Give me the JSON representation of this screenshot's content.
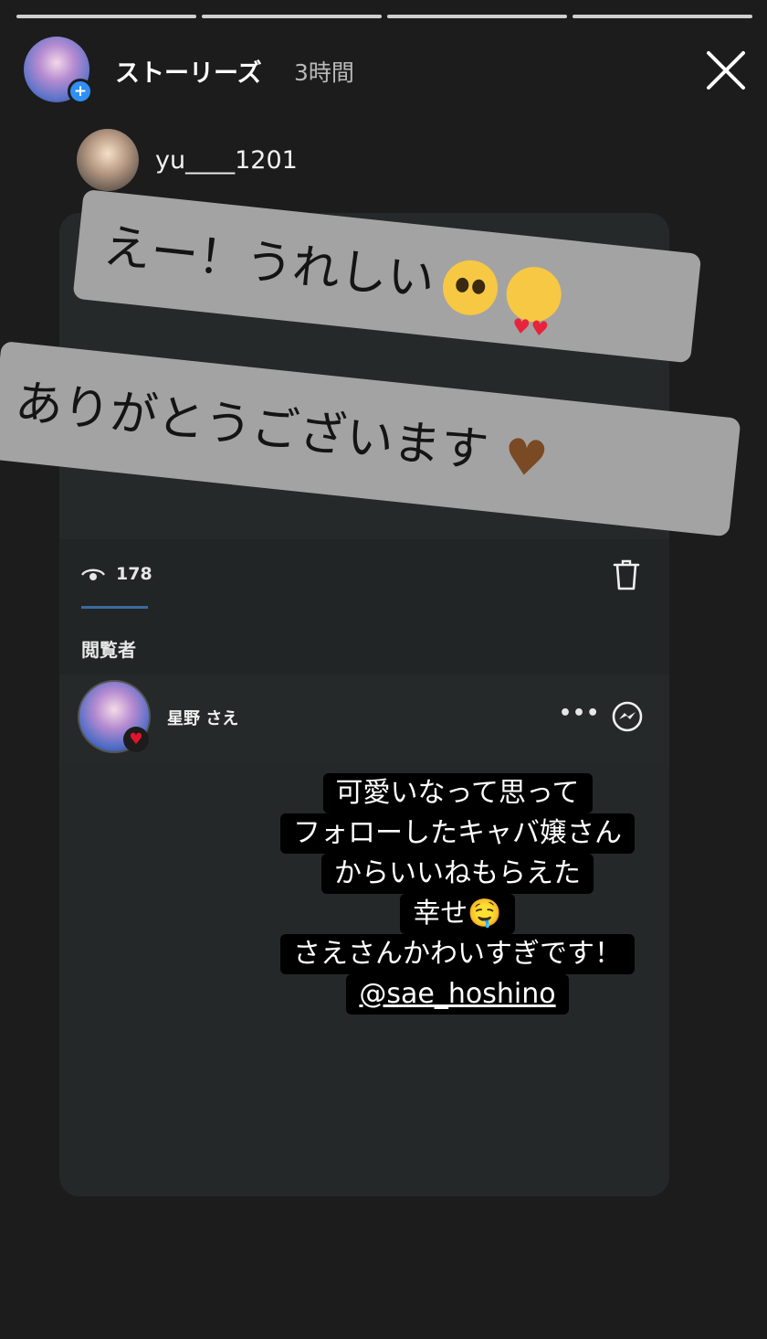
{
  "header": {
    "title": "ストーリーズ",
    "time": "3時間",
    "close_icon": "close-icon",
    "add_icon": "plus-icon"
  },
  "progress": {
    "segments": 4,
    "active_segment": 4
  },
  "repost": {
    "username": "yu____1201",
    "sticker_line_1": "えー！うれしい",
    "sticker_line_1_emojis": [
      "pleading-face-emoji",
      "heart-eyes-emoji"
    ],
    "sticker_line_2": "ありがとうございます",
    "sticker_line_2_emojis": [
      "brown-heart-emoji"
    ]
  },
  "stats": {
    "views_icon": "eye-icon",
    "views": "178",
    "delete_icon": "trash-icon"
  },
  "viewers": {
    "title": "閲覧者",
    "items": [
      {
        "name": "星野 さえ",
        "liked": true,
        "more_icon": "more-icon",
        "message_icon": "messenger-icon"
      }
    ]
  },
  "caption": {
    "lines": [
      "可愛いなって思って",
      "フォローしたキャバ嬢さん",
      "からいいねもらえた",
      "幸せ🤤",
      "さえさんかわいすぎです！"
    ],
    "mention": "@sae_hoshino"
  },
  "colors": {
    "background": "#1c1c1c",
    "sticker": "#a3a3a3",
    "accent_blue": "#2f8ff6",
    "heart_red": "#e0142c"
  }
}
